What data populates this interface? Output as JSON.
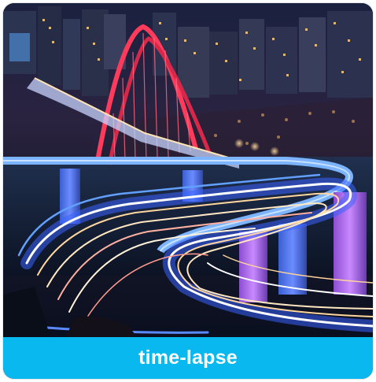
{
  "card": {
    "caption": "time-lapse",
    "image_subject": "night-city-bridge-highway-light-trails"
  },
  "colors": {
    "caption_bar": "#0ab8f0",
    "caption_text": "#ffffff",
    "sky": "#1a1f3a",
    "bridge_arch": "#e8385a",
    "highway_glow": "#6aa8ff",
    "light_trails": "#ffe9c8"
  }
}
